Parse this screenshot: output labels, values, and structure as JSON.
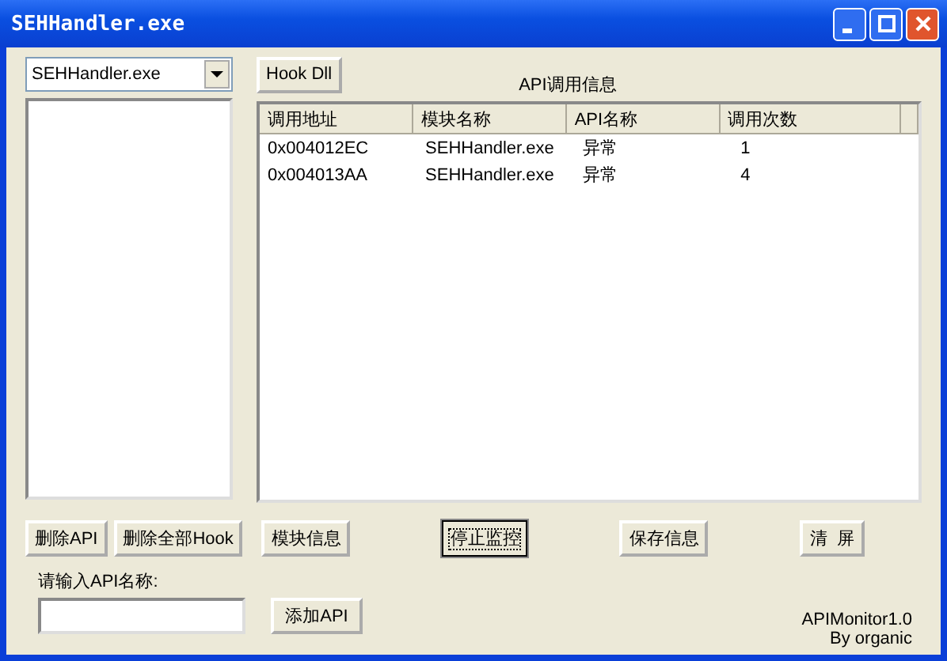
{
  "window": {
    "title": "SEHHandler.exe"
  },
  "process_dropdown": {
    "value": "SEHHandler.exe"
  },
  "hook_button": "Hook Dll",
  "table_title": "API调用信息",
  "table": {
    "columns": [
      "调用地址",
      "模块名称",
      "API名称",
      "调用次数"
    ],
    "rows": [
      [
        "0x004012EC",
        "SEHHandler.exe",
        "异常",
        "1"
      ],
      [
        "0x004013AA",
        "SEHHandler.exe",
        "异常",
        "4"
      ]
    ]
  },
  "buttons": [
    {
      "label": "删除API",
      "default": false
    },
    {
      "label": "删除全部Hook",
      "default": false
    },
    {
      "label": "模块信息",
      "default": false
    },
    {
      "label": "停止监控",
      "default": true
    },
    {
      "label": "保存信息",
      "default": false
    },
    {
      "label": "清  屏",
      "default": false
    }
  ],
  "api_name_label": "请输入API名称:",
  "add_api_button": "添加API",
  "footer": [
    "APIMonitor1.0",
    "By organic"
  ]
}
